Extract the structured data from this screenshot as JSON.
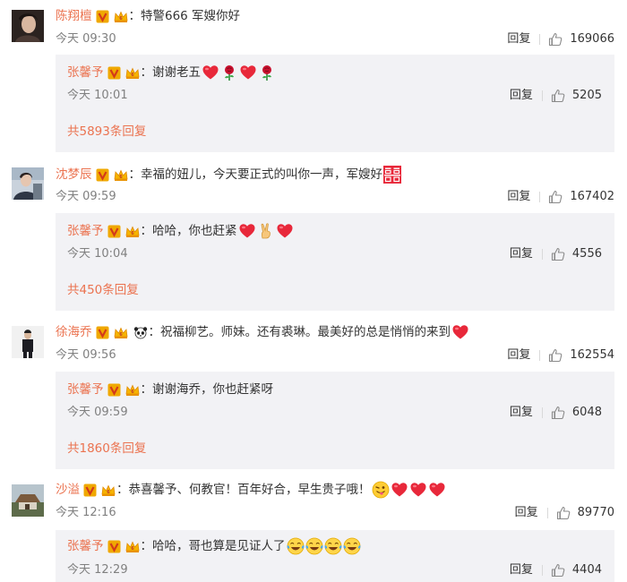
{
  "comments": [
    {
      "user": "陈翔檀",
      "text": "特警666 军嫂你好",
      "time": "今天 09:30",
      "reply_label": "回复",
      "likes": "169066",
      "emojis": [],
      "sub": {
        "user": "张馨予",
        "text": "谢谢老五",
        "emojis": [
          "heart",
          "rose",
          "heart",
          "rose"
        ],
        "time": "今天 10:01",
        "reply_label": "回复",
        "likes": "5205",
        "more": "共5893条回复"
      }
    },
    {
      "user": "沈梦辰",
      "text": "幸福的妞儿，今天要正式的叫你一声，军嫂好",
      "emojis": [
        "double-happiness"
      ],
      "time": "今天 09:59",
      "reply_label": "回复",
      "likes": "167402",
      "sub": {
        "user": "张馨予",
        "text": "哈哈，你也赶紧",
        "emojis": [
          "heart",
          "victory",
          "heart"
        ],
        "time": "今天 10:04",
        "reply_label": "回复",
        "likes": "4556",
        "more": "共450条回复"
      }
    },
    {
      "user": "徐海乔",
      "text": "祝福柳艺。师妹。还有裘琳。最美好的总是悄悄的来到",
      "emojis": [
        "heart"
      ],
      "time": "今天 09:56",
      "reply_label": "回复",
      "likes": "162554",
      "sub": {
        "user": "张馨予",
        "text": "谢谢海乔，你也赶紧呀",
        "emojis": [],
        "time": "今天 09:59",
        "reply_label": "回复",
        "likes": "6048",
        "more": "共1860条回复"
      }
    },
    {
      "user": "沙溢",
      "text": "恭喜馨予、何教官！百年好合，早生贵子哦！",
      "emojis": [
        "tongue-face",
        "heart",
        "heart",
        "heart"
      ],
      "time": "今天 12:16",
      "reply_label": "回复",
      "likes": "89770",
      "sub": {
        "user": "张馨予",
        "text": "哈哈，哥也算是见证人了",
        "emojis": [
          "laugh-cry",
          "laugh-cry",
          "laugh-cry",
          "laugh-cry"
        ],
        "time": "今天 12:29",
        "reply_label": "回复",
        "likes": "4404",
        "more": ""
      }
    }
  ],
  "colon": "：",
  "colors": {
    "username": "#eb7350",
    "sub_bg": "#f2f2f5",
    "time": "#808080",
    "verified": "#f0a800"
  }
}
